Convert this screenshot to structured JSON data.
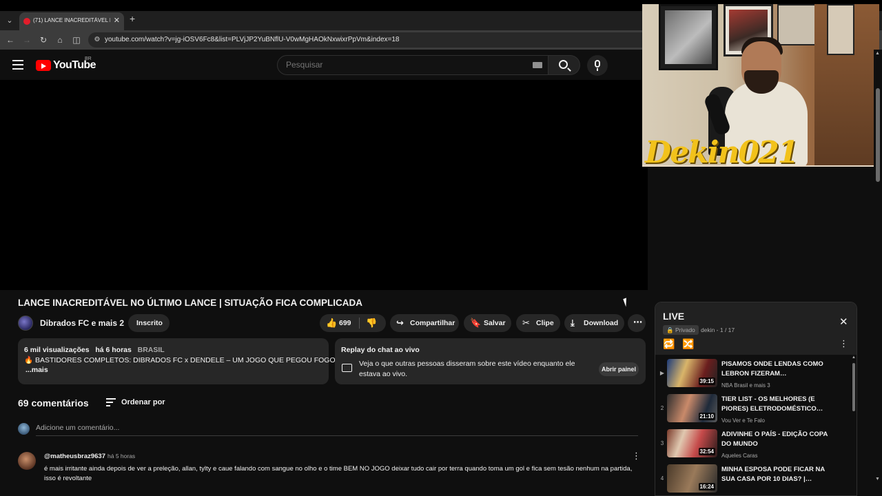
{
  "browser": {
    "tab_title": "(71) LANCE INACREDITÁVEL NO ÚLTIMO LANCE | SITUAÇÃO FICA COMPLICADA",
    "url": "youtube.com/watch?v=jg-iOSV6Fc8&list=PLVjJP2YuBNflU-V0wMgHAOkNxwixrPpVm&index=18"
  },
  "header": {
    "logo_text": "YouTube",
    "country_code": "BR",
    "search_placeholder": "Pesquisar"
  },
  "webcam": {
    "handle": "Dekin021"
  },
  "video": {
    "title": "LANCE INACREDITÁVEL NO ÚLTIMO LANCE | SITUAÇÃO FICA COMPLICADA",
    "channel": "Dibrados FC e mais 2",
    "subscribed_label": "Inscrito",
    "likes": "699",
    "share_label": "Compartilhar",
    "save_label": "Salvar",
    "clip_label": "Clipe",
    "download_label": "Download"
  },
  "description": {
    "views": "6 mil visualizações",
    "age": "há 6 horas",
    "country": "BRASIL",
    "line": "🔥 BASTIDORES COMPLETOS: DIBRADOS FC x DENDELE – UM JOGO QUE PEGOU FOGO!",
    "more": "...mais"
  },
  "chat_replay": {
    "title": "Replay do chat ao vivo",
    "text": "Veja o que outras pessoas disseram sobre este vídeo enquanto ele estava ao vivo.",
    "button": "Abrir painel"
  },
  "comments": {
    "count_label": "69 comentários",
    "sort_label": "Ordenar por",
    "add_placeholder": "Adicione um comentário...",
    "items": [
      {
        "author": "@matheusbraz9637",
        "time": "há 5 horas",
        "text": "é mais irritante ainda depois de ver a preleção, allan, tylty e caue falando com sangue no olho e o time BEM NO JOGO deixar tudo cair por terra quando toma um gol e fica sem tesão nenhum na partida, isso é revoltante"
      }
    ]
  },
  "playlist": {
    "title": "LIVE",
    "privacy": "Privado",
    "owner": "dekin - 1 / 17",
    "items": [
      {
        "index": "▶",
        "title": "PISAMOS ONDE LENDAS COMO LEBRON FIZERAM…",
        "channel": "NBA Brasil e mais 3",
        "duration": "39:15"
      },
      {
        "index": "2",
        "title": "TIER LIST - OS MELHORES (E PIORES) ELETRODOMÉSTICO…",
        "channel": "Vou Ver e Te Falo",
        "duration": "21:10"
      },
      {
        "index": "3",
        "title": "ADIVINHE O PAÍS - EDIÇÃO COPA DO MUNDO",
        "channel": "Aqueles Caras",
        "duration": "32:54"
      },
      {
        "index": "4",
        "title": "MINHA ESPOSA PODE FICAR NA SUA CASA POR 10 DIAS? |…",
        "channel": "",
        "duration": "16:24"
      }
    ]
  },
  "colors": {
    "background": "#0f0f0f",
    "surface": "#272727",
    "brand_red": "#ff0000",
    "handle_yellow": "#f2c21b"
  }
}
